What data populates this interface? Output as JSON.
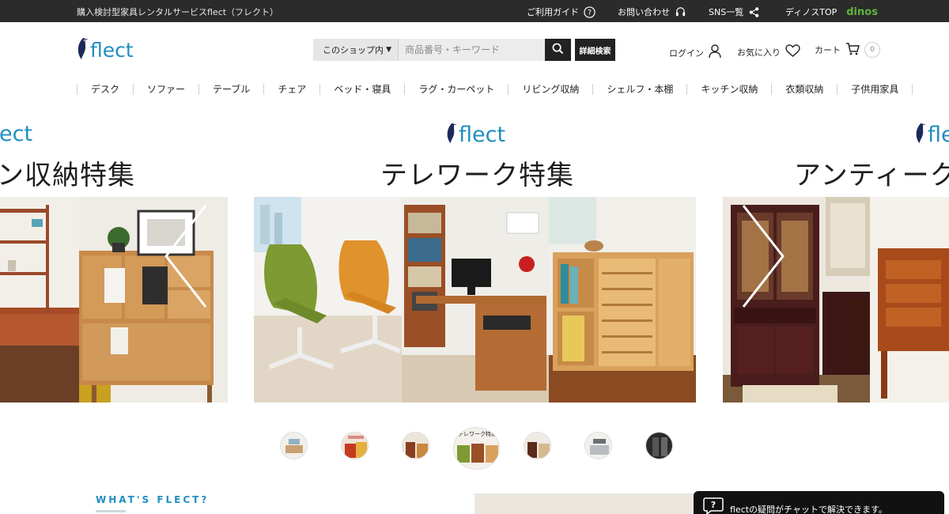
{
  "topbar": {
    "tagline": "購入検討型家具レンタルサービスflect（フレクト）",
    "guide": "ご利用ガイド",
    "contact": "お問い合わせ",
    "sns": "SNS一覧",
    "dinos_top": "ディノスTOP",
    "dinos_logo": "dinos"
  },
  "header": {
    "logo_text": "flect",
    "search_scope": "このショップ内",
    "search_placeholder": "商品番号・キーワード",
    "advanced_search": "詳細検索",
    "login": "ログイン",
    "favorites": "お気に入り",
    "cart": "カート",
    "cart_count": "0"
  },
  "categories": [
    "デスク",
    "ソファー",
    "テーブル",
    "チェア",
    "ベッド・寝具",
    "ラグ・カーペット",
    "リビング収納",
    "シェルフ・本棚",
    "キッチン収納",
    "衣類収納",
    "子供用家具"
  ],
  "carousel": {
    "slides": [
      {
        "brand": "flect",
        "title": "ン収納特集"
      },
      {
        "brand": "flect",
        "title": "テレワーク特集"
      },
      {
        "brand": "flect",
        "title": "アンティーク"
      }
    ],
    "active_thumb_label": "テレワーク特集",
    "thumb_count": 7,
    "active_thumb_index": 3
  },
  "about": {
    "heading": "WHAT'S FLECT?"
  },
  "chat": {
    "text": "flectの疑問がチャットで解決できます。"
  },
  "colors": {
    "brand_blue": "#1f8fc0",
    "topbar_bg": "#2b2b2b",
    "dinos_green": "#62b342",
    "navy": "#1b2a5a"
  }
}
